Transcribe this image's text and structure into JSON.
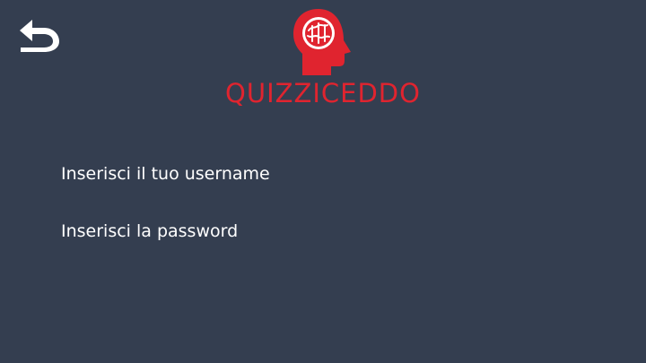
{
  "app": {
    "logo_text": "QUIZZICEDDO"
  },
  "form": {
    "username_prompt": "Inserisci il tuo username",
    "password_prompt": "Inserisci la password"
  },
  "icons": {
    "back": "back-arrow-icon",
    "logo": "brain-head-icon"
  },
  "colors": {
    "background": "#343e50",
    "brand": "#e0242f",
    "text": "#ffffff"
  }
}
